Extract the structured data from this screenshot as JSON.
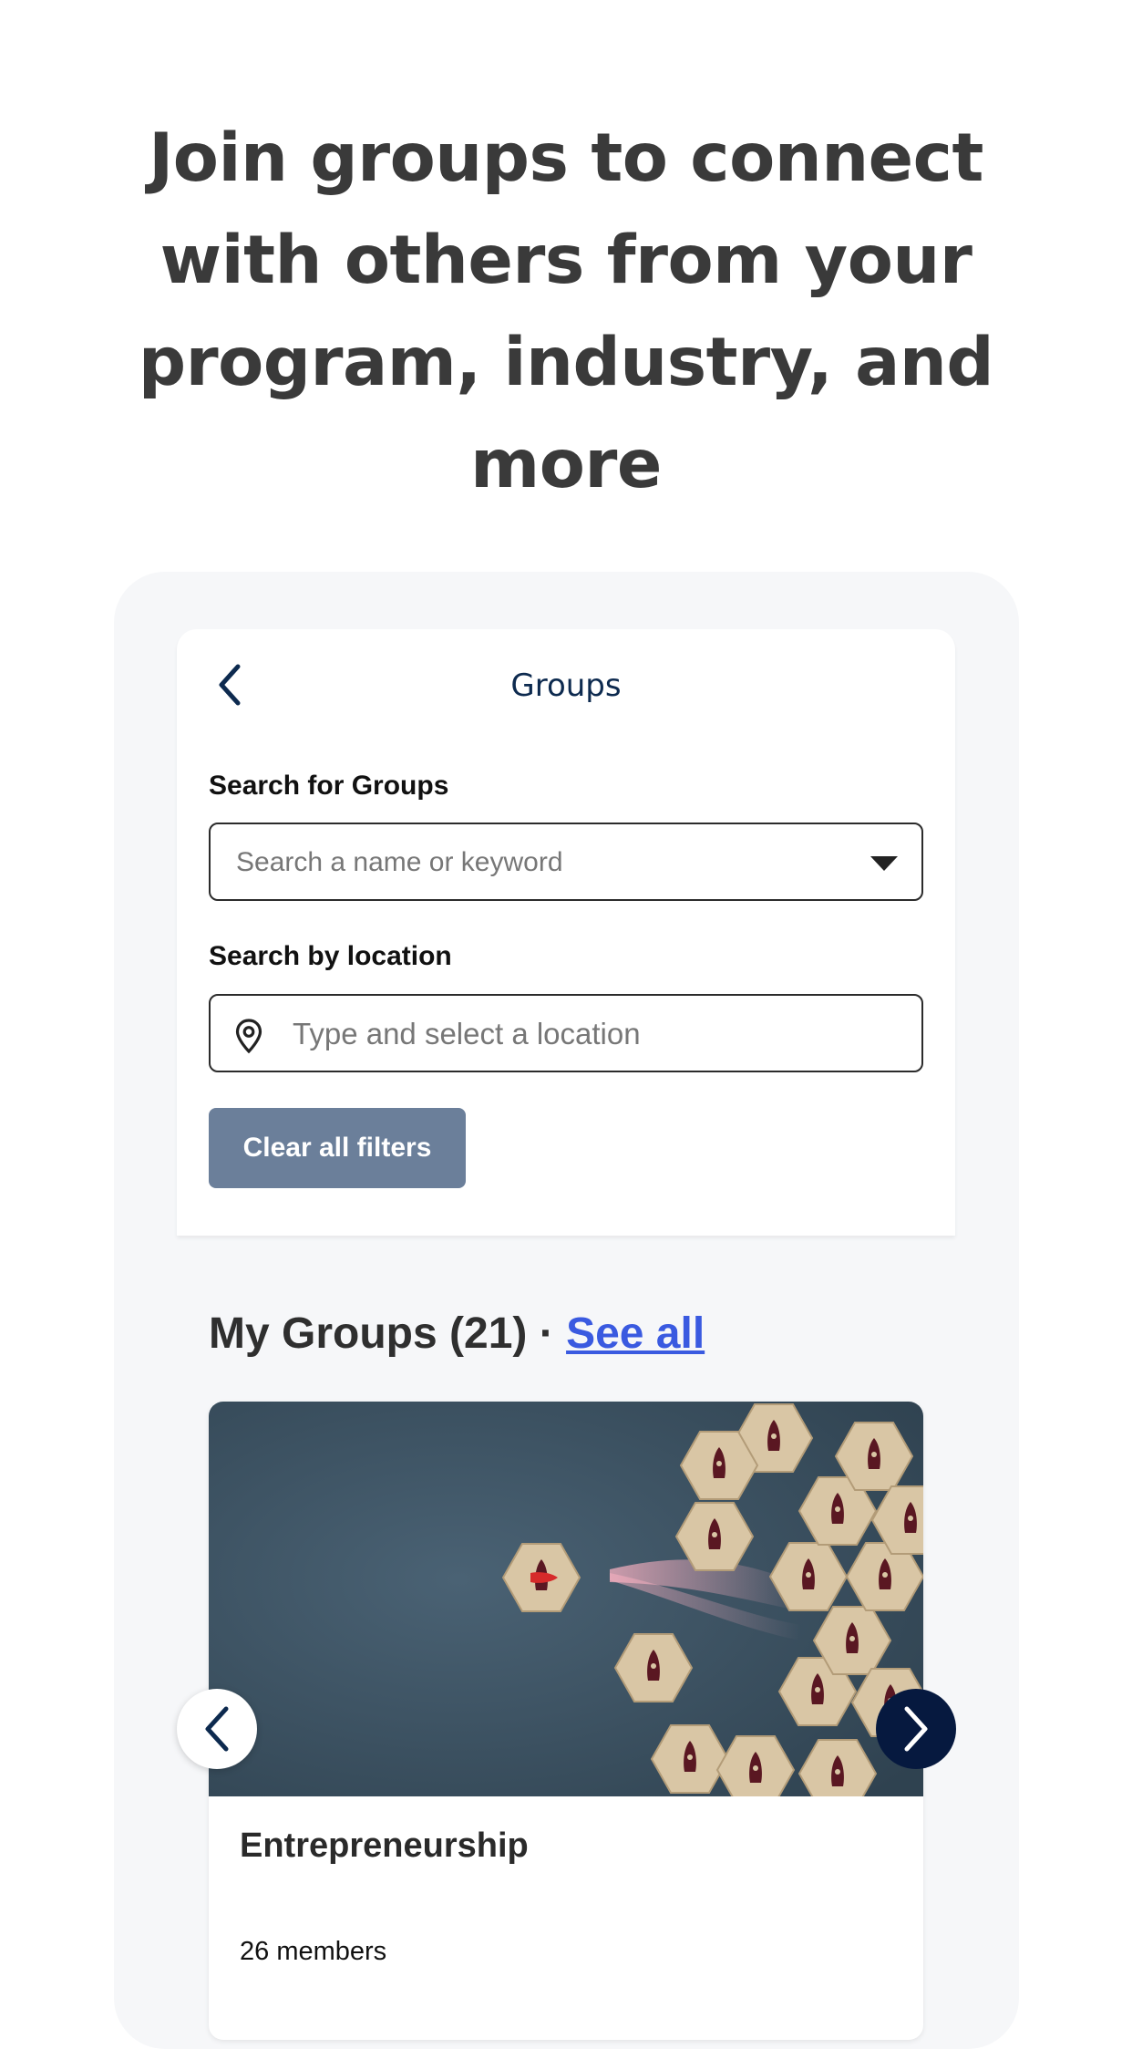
{
  "promo": {
    "headline_lines": [
      "Join groups to connect",
      "with others from your",
      "program, industry, and",
      "more"
    ]
  },
  "header": {
    "title": "Groups",
    "back_icon": "chevron-left-icon"
  },
  "search": {
    "groups_label": "Search for Groups",
    "groups_placeholder": "Search a name or keyword",
    "location_label": "Search by location",
    "location_placeholder": "Type and select a location",
    "clear_label": "Clear all filters"
  },
  "my_groups": {
    "title": "My Groups (21)",
    "separator": "·",
    "see_all": "See all",
    "card": {
      "name": "Entrepreneurship",
      "members": "26 members"
    }
  },
  "colors": {
    "title_navy": "#0d2a4f",
    "clear_button": "#6b7f9a",
    "link": "#3a5ae0",
    "next_button": "#06193f"
  }
}
